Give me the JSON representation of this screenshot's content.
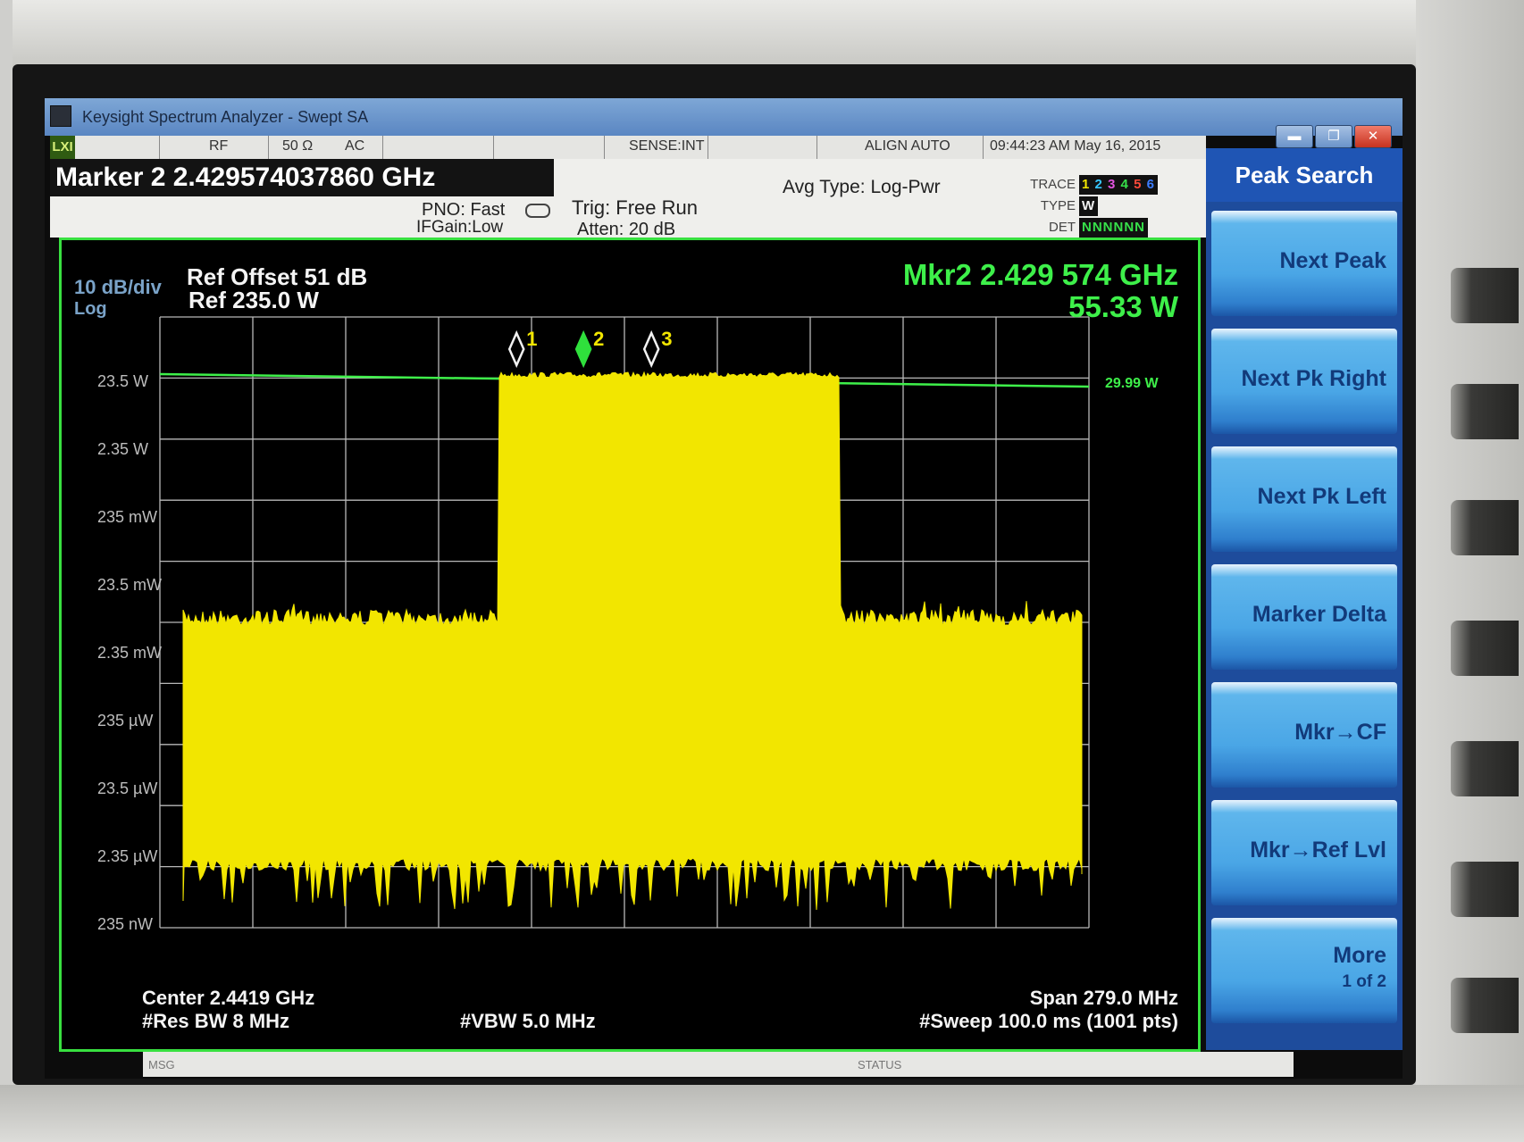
{
  "window": {
    "title": "Keysight Spectrum Analyzer - Swept SA",
    "lxi_badge": "LXI",
    "minimize_glyph": "▬",
    "restore_glyph": "❐",
    "close_glyph": "✕"
  },
  "status_bar": {
    "rf": "RF",
    "impedance": "50 Ω",
    "coupling": "AC",
    "sense": "SENSE:INT",
    "align": "ALIGN AUTO",
    "datetime": "09:44:23 AM May 16, 2015"
  },
  "info": {
    "marker_banner": "Marker 2  2.429574037860 GHz",
    "pno": "PNO: Fast",
    "ifgain": "IFGain:Low",
    "trig": "Trig: Free Run",
    "atten": "Atten: 20 dB",
    "avg_type": "Avg Type: Log-Pwr",
    "trace_label": "TRACE",
    "type_label": "TYPE",
    "det_label": "DET",
    "trace_numbers": [
      "1",
      "2",
      "3",
      "4",
      "5",
      "6"
    ],
    "trace_colors": [
      "#f2e600",
      "#37c6ff",
      "#e254e0",
      "#37e14a",
      "#ff4a3a",
      "#3c7dff"
    ],
    "type_value": "W",
    "det_value": "NNNNNN"
  },
  "plot": {
    "ref_offset": "Ref Offset 51 dB",
    "ref_level": "Ref 235.0 W",
    "scale_div": "10 dB/div",
    "scale_type": "Log",
    "marker_readout_freq": "Mkr2 2.429 574 GHz",
    "marker_readout_value": "55.33 W",
    "threshold_label": "29.99 W",
    "y_ticks": [
      "23.5 W",
      "2.35 W",
      "235 mW",
      "23.5 mW",
      "2.35 mW",
      "235 µW",
      "23.5 µW",
      "2.35 µW",
      "235 nW"
    ],
    "markers": [
      {
        "id": "1",
        "x_ghz": 2.4095,
        "active": false
      },
      {
        "id": "2",
        "x_ghz": 2.4296,
        "active": true
      },
      {
        "id": "3",
        "x_ghz": 2.45,
        "active": false
      }
    ],
    "trace_color": "#f2e600",
    "grid_color": "#b8b8b8",
    "threshold_color": "#3ef04a"
  },
  "footer": {
    "center": "Center 2.4419 GHz",
    "res_bw": "#Res BW 8 MHz",
    "vbw": "#VBW 5.0 MHz",
    "span": "Span 279.0 MHz",
    "sweep": "#Sweep  100.0 ms (1001 pts)"
  },
  "bottom_bar": {
    "msg": "MSG",
    "status": "STATUS"
  },
  "softkeys": {
    "menu_title": "Peak Search",
    "items": [
      {
        "label": "Next Peak"
      },
      {
        "label": "Next Pk Right"
      },
      {
        "label": "Next Pk Left"
      },
      {
        "label": "Marker Delta"
      },
      {
        "label": "Mkr→CF"
      },
      {
        "label": "Mkr→Ref Lvl"
      },
      {
        "label": "More",
        "sub": "1 of 2"
      }
    ]
  }
}
